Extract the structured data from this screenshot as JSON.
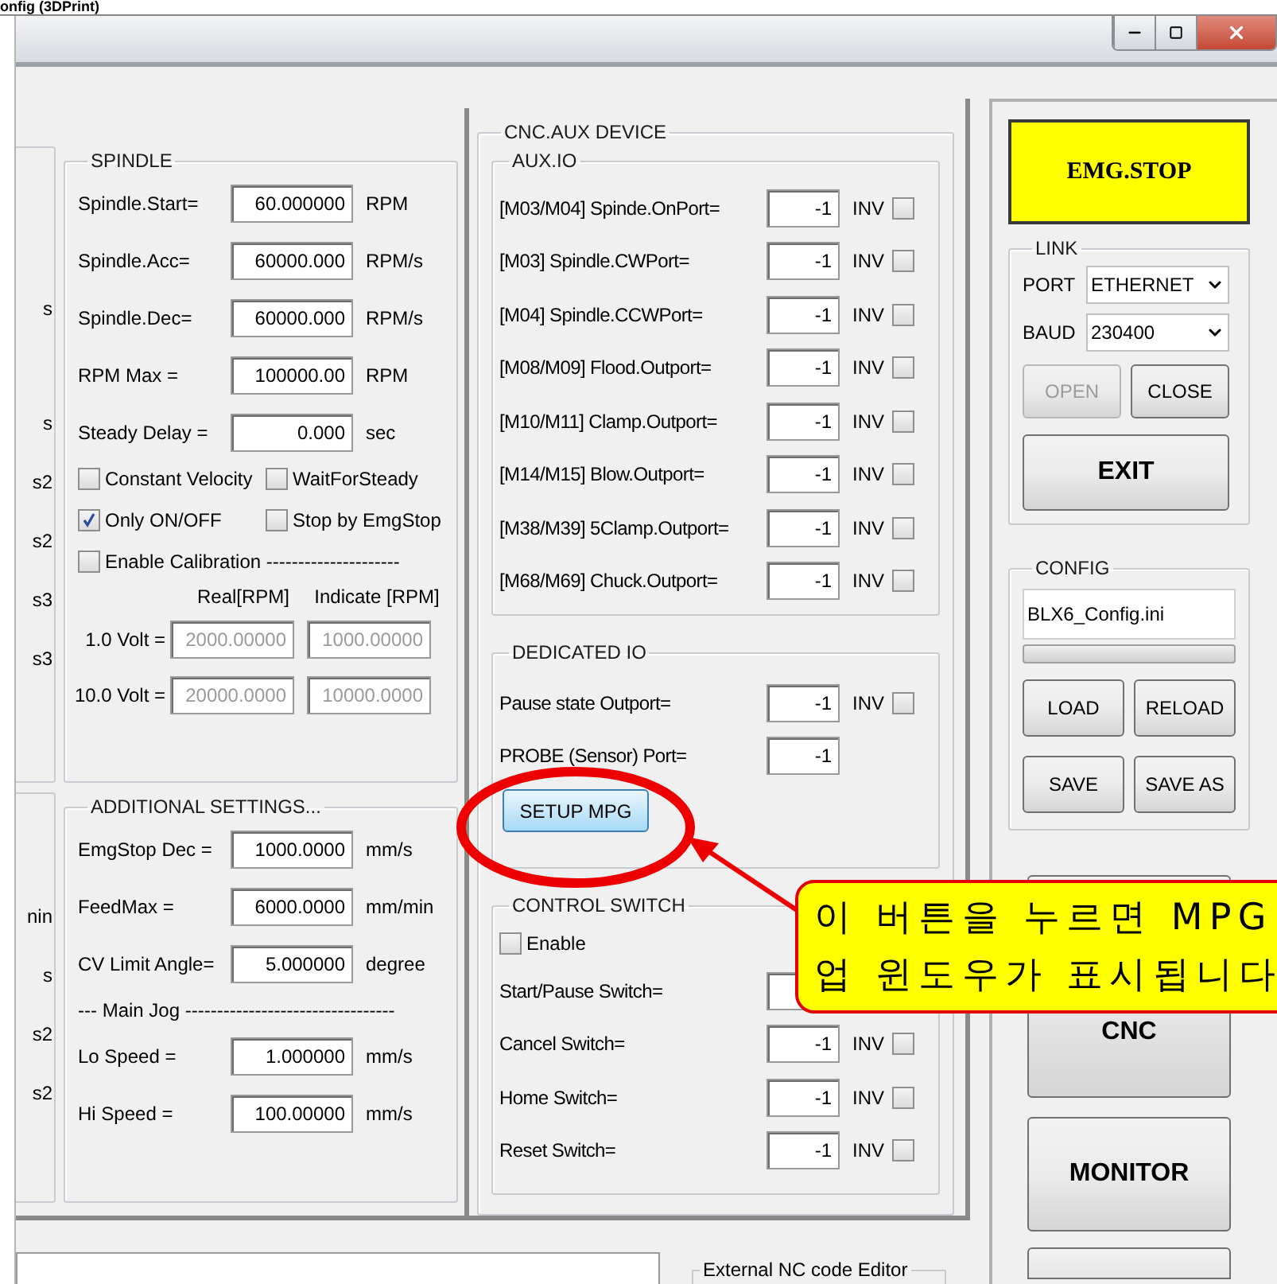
{
  "background_window": {
    "title": "onfig (3DPrint)"
  },
  "window_controls": [
    {
      "kind": "minimize"
    },
    {
      "kind": "maximize"
    },
    {
      "kind": "close"
    }
  ],
  "left_fragments_top": [
    "s",
    "s",
    "s2",
    "s2",
    "s3",
    "s3"
  ],
  "left_fragments_bottom": [
    "nin",
    "s",
    "s2",
    "s2"
  ],
  "spindle": {
    "title": "SPINDLE",
    "rows": [
      {
        "label": "Spindle.Start=",
        "value": "60.000000",
        "unit": "RPM"
      },
      {
        "label": "Spindle.Acc=",
        "value": "60000.000",
        "unit": "RPM/s"
      },
      {
        "label": "Spindle.Dec=",
        "value": "60000.000",
        "unit": "RPM/s"
      },
      {
        "label": "RPM Max =",
        "value": "100000.00",
        "unit": "RPM"
      },
      {
        "label": "Steady Delay =",
        "value": "0.000",
        "unit": "sec"
      }
    ],
    "options": [
      {
        "label": "Constant Velocity",
        "checked": false
      },
      {
        "label": "WaitForSteady",
        "checked": false
      },
      {
        "label": "Only ON/OFF",
        "checked": true
      },
      {
        "label": "Stop by EmgStop",
        "checked": false
      }
    ],
    "calibration": {
      "label": "Enable Calibration ---------------------",
      "checked": false,
      "disabled": true,
      "columns": [
        "Real[RPM]",
        "Indicate [RPM]"
      ],
      "rows": [
        {
          "label": "1.0 Volt =",
          "values": [
            "2000.00000",
            "1000.00000"
          ]
        },
        {
          "label": "10.0 Volt =",
          "values": [
            "20000.0000",
            "10000.0000"
          ]
        }
      ]
    }
  },
  "additional": {
    "title": "ADDITIONAL SETTINGS...",
    "rows": [
      {
        "label": "EmgStop Dec =",
        "value": "1000.0000",
        "unit": "mm/s"
      },
      {
        "label": "FeedMax =",
        "value": "6000.0000",
        "unit": "mm/min"
      },
      {
        "label": "CV Limit Angle=",
        "value": "5.000000",
        "unit": "degree"
      }
    ],
    "separator": "--- Main Jog ---------------------------------",
    "jog_rows": [
      {
        "label": "Lo Speed =",
        "value": "1.000000",
        "unit": "mm/s"
      },
      {
        "label": "Hi Speed =",
        "value": "100.00000",
        "unit": "mm/s"
      }
    ]
  },
  "aux_device": {
    "title": "CNC.AUX DEVICE",
    "aux_io": {
      "title": "AUX.IO",
      "rows": [
        {
          "label": "[M03/M04] Spinde.OnPort=",
          "value": "-1",
          "inv_label": "INV",
          "inv": false
        },
        {
          "label": "[M03] Spindle.CWPort=",
          "value": "-1",
          "inv_label": "INV",
          "inv": false
        },
        {
          "label": "[M04] Spindle.CCWPort=",
          "value": "-1",
          "inv_label": "INV",
          "inv": false
        },
        {
          "label": "[M08/M09] Flood.Outport=",
          "value": "-1",
          "inv_label": "INV",
          "inv": false
        },
        {
          "label": "[M10/M11] Clamp.Outport=",
          "value": "-1",
          "inv_label": "INV",
          "inv": false
        },
        {
          "label": "[M14/M15] Blow.Outport=",
          "value": "-1",
          "inv_label": "INV",
          "inv": false
        },
        {
          "label": "[M38/M39] 5Clamp.Outport=",
          "value": "-1",
          "inv_label": "INV",
          "inv": false
        },
        {
          "label": "[M68/M69] Chuck.Outport=",
          "value": "-1",
          "inv_label": "INV",
          "inv": false
        }
      ]
    },
    "dedicated_io": {
      "title": "DEDICATED IO",
      "rows": [
        {
          "label": "Pause state Outport=",
          "value": "-1",
          "inv_label": "INV",
          "inv": false
        },
        {
          "label": "PROBE (Sensor) Port=",
          "value": "-1"
        }
      ],
      "button": "SETUP MPG"
    },
    "control_switch": {
      "title": "CONTROL SWITCH",
      "enable": {
        "label": "Enable",
        "checked": false
      },
      "rows": [
        {
          "label": "Start/Pause Switch="
        },
        {
          "label": "Cancel Switch=",
          "value": "-1",
          "inv_label": "INV",
          "inv": false
        },
        {
          "label": "Home Switch=",
          "value": "-1",
          "inv_label": "INV",
          "inv": false
        },
        {
          "label": "Reset Switch=",
          "value": "-1",
          "inv_label": "INV",
          "inv": false
        }
      ]
    }
  },
  "bottom": {
    "editor_group": "External NC code Editor"
  },
  "right_panel": {
    "emg_stop": "EMG.STOP",
    "link": {
      "title": "LINK",
      "port_label": "PORT",
      "port": "ETHERNET",
      "baud_label": "BAUD",
      "baud": "230400",
      "buttons": [
        {
          "label": "OPEN",
          "disabled": true
        },
        {
          "label": "CLOSE",
          "disabled": false
        }
      ],
      "exit": "EXIT"
    },
    "config": {
      "title": "CONFIG",
      "file": "BLX6_Config.ini",
      "progress": {
        "level": 0
      },
      "buttons": [
        "LOAD",
        "RELOAD",
        "SAVE",
        "SAVE AS"
      ]
    },
    "cnc": "CNC",
    "monitor": "MONITOR"
  },
  "callout": {
    "lines": [
      "이 버튼을 누르면 MPG",
      "업 윈도우가 표시됩니다"
    ]
  }
}
